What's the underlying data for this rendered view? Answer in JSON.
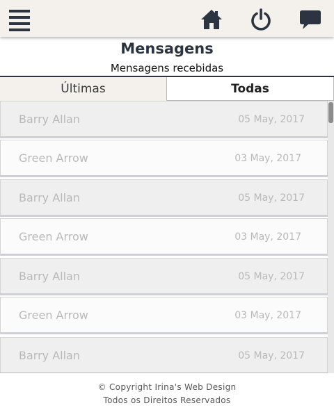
{
  "topbar": {
    "icons": {
      "menu": "hamburger-menu-icon",
      "home": "home-icon",
      "power": "power-icon",
      "chat": "chat-bubble-icon"
    },
    "icon_color": "#2b3440",
    "background": "#f4f1ec"
  },
  "header": {
    "title": "Mensagens",
    "subtitle": "Mensagens recebidas"
  },
  "tabs": [
    {
      "label": "Últimas",
      "active": false
    },
    {
      "label": "Todas",
      "active": true
    }
  ],
  "messages": [
    {
      "name": "Barry Allan",
      "date": "05 May, 2017"
    },
    {
      "name": "Green Arrow",
      "date": "03 May, 2017"
    },
    {
      "name": "Barry Allan",
      "date": "05 May, 2017"
    },
    {
      "name": "Green Arrow",
      "date": "03 May, 2017"
    },
    {
      "name": "Barry Allan",
      "date": "05 May, 2017"
    },
    {
      "name": "Green Arrow",
      "date": "03 May, 2017"
    },
    {
      "name": "Barry Allan",
      "date": "05 May, 2017"
    }
  ],
  "footer": {
    "copyright": "© Copyright Irina's Web Design",
    "rights": "Todos os Direitos Reservados"
  }
}
